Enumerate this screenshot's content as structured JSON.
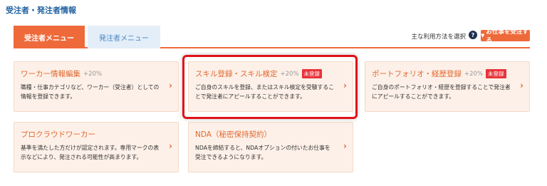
{
  "page_title": "受注者・発注者情報",
  "tabs": [
    {
      "label": "受注者メニュー"
    },
    {
      "label": "発注者メニュー"
    }
  ],
  "usage": {
    "label": "主な利用方法を選択",
    "help_icon": "question-circle-icon"
  },
  "order_button": {
    "label": "お仕事を受注する",
    "icon": "chevron-down-icon"
  },
  "cards": [
    {
      "title": "ワーカー情報編集",
      "pct": "+20%",
      "badge": "",
      "desc": "職種・仕事カテゴリなど、ワーカー（受注者）としての情報を登録できます。"
    },
    {
      "title": "スキル登録・スキル検定",
      "pct": "+20%",
      "badge": "未登録",
      "desc": "ご自身のスキルを登録、またはスキル検定を受験することで発注者にアピールすることができます。"
    },
    {
      "title": "ポートフォリオ・経歴登録",
      "pct": "+20%",
      "badge": "未登録",
      "desc": "ご自身のポートフォリオ・経歴を登録することで発注者にアピールすることができます。"
    },
    {
      "title": "プロクラウドワーカー",
      "pct": "",
      "badge": "",
      "desc": "基準を満たした方だけが認定されます。専用マークの表示などにより、発注される可能性が高まります。"
    },
    {
      "title": "NDA（秘密保持契約）",
      "pct": "",
      "badge": "",
      "desc": "NDAを締結すると、NDAオプションの付いたお仕事を受注できるようになります。"
    }
  ],
  "colors": {
    "accent": "#ef6a3a",
    "title_blue": "#1f5f9f",
    "badge_red": "#e8333a",
    "highlight": "#e0121a"
  }
}
